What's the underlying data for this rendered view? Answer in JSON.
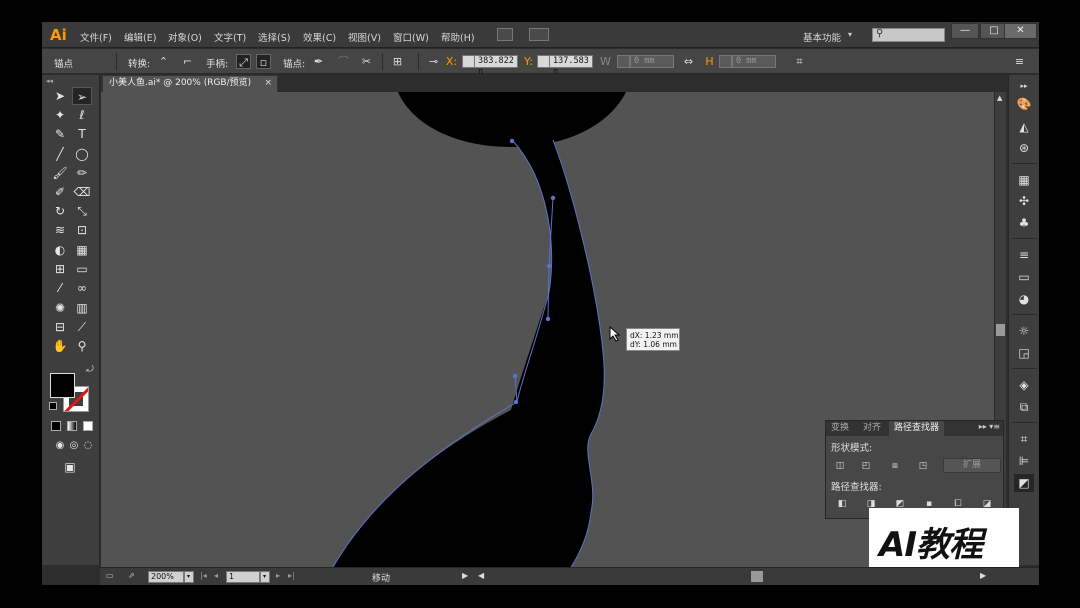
{
  "app": {
    "logo": "Ai",
    "menus": [
      "文件(F)",
      "编辑(E)",
      "对象(O)",
      "文字(T)",
      "选择(S)",
      "效果(C)",
      "视图(V)",
      "窗口(W)",
      "帮助(H)"
    ],
    "workspace": "基本功能",
    "window_buttons": {
      "minimize": "—",
      "maximize": "□",
      "close": "✕"
    }
  },
  "control_bar": {
    "selection_label": "锚点",
    "convert_label": "转换:",
    "handles_label": "手柄:",
    "anchors_label": "锚点:",
    "x_label": "X:",
    "x_value": "383.822 n",
    "y_label": "Y:",
    "y_value": "137.583 n",
    "w_value": "0 mm",
    "h_value": "0 mm"
  },
  "document_tab": {
    "title": "小美人鱼.ai* @ 200% (RGB/预览)",
    "close": "×"
  },
  "tooltip": {
    "dx": "dX: 1.23 mm",
    "dy": "dY: 1.06 mm"
  },
  "pathfinder_panel": {
    "tabs": [
      "变换",
      "对齐",
      "路径查找器"
    ],
    "shape_modes_label": "形状模式:",
    "pathfinders_label": "路径查找器:",
    "expand_button": "扩展"
  },
  "status_bar": {
    "zoom": "200%",
    "page": "1",
    "status": "移动"
  },
  "watermark": "AI教程",
  "colors": {
    "accent": "#ff9a00",
    "path_outline": "#5a73c8",
    "fill": "#000000",
    "canvas": "#535353"
  }
}
